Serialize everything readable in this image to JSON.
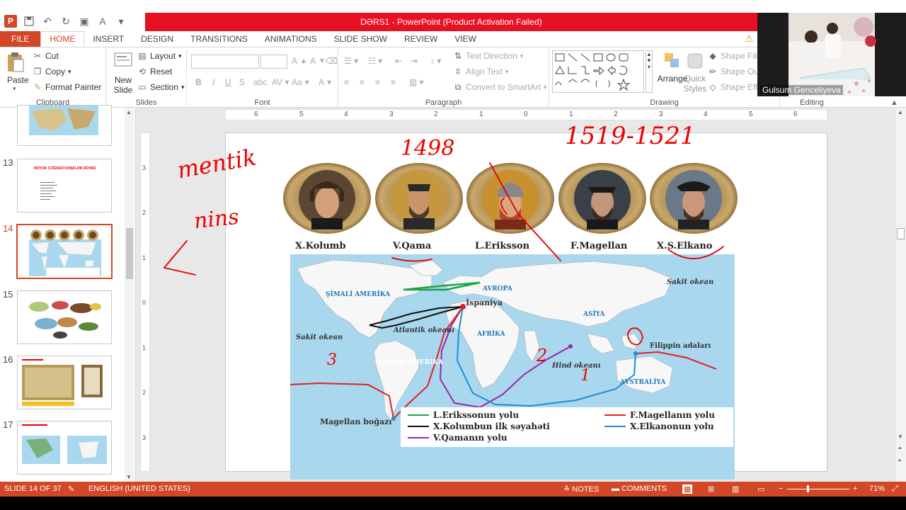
{
  "window": {
    "title": "DƏRS1 - PowerPoint (Product Activation Failed)",
    "app_icon_letter": "P"
  },
  "tabs": [
    "FILE",
    "HOME",
    "INSERT",
    "DESIGN",
    "TRANSITIONS",
    "ANIMATIONS",
    "SLIDE SHOW",
    "REVIEW",
    "VIEW"
  ],
  "active_tab": "HOME",
  "ribbon": {
    "clipboard": {
      "label": "Clipboard",
      "paste": "Paste",
      "cut": "Cut",
      "copy": "Copy",
      "format_painter": "Format Painter"
    },
    "slides": {
      "label": "Slides",
      "new_slide": "New Slide",
      "layout": "Layout",
      "reset": "Reset",
      "section": "Section"
    },
    "font": {
      "label": "Font",
      "bold": "B",
      "italic": "I",
      "underline": "U",
      "strike": "S",
      "aa": "Aa",
      "font_color": "A"
    },
    "paragraph": {
      "label": "Paragraph",
      "text_direction": "Text Direction",
      "align_text": "Align Text",
      "convert_smartart": "Convert to SmartArt"
    },
    "drawing": {
      "label": "Drawing",
      "arrange": "Arrange",
      "quick_styles": "Quick Styles",
      "shape_fill": "Shape Fill",
      "shape_outline": "Shape Outl",
      "shape_effects": "Shape Effe"
    },
    "editing": {
      "label": "Editing"
    }
  },
  "ruler": {
    "marks": [
      "6",
      "5",
      "4",
      "3",
      "2",
      "1",
      "0",
      "1",
      "2",
      "3",
      "4",
      "5",
      "6"
    ]
  },
  "vruler": {
    "marks": [
      "3",
      "2",
      "1",
      "0",
      "1",
      "2",
      "3"
    ]
  },
  "thumbnails": [
    {
      "num": "13",
      "title": "BÖYÜK COĞRAFİ KƏŞFLƏR DÖVRÜ"
    },
    {
      "num": "14",
      "selected": true
    },
    {
      "num": "15"
    },
    {
      "num": "16"
    },
    {
      "num": "17"
    }
  ],
  "slide": {
    "explorers": [
      "X.Kolumb",
      "V.Qama",
      "L.Eriksson",
      "F.Magellan",
      "X.S.Elkano"
    ],
    "map_labels": {
      "north_america": "ŞİMALİ AMERİKA",
      "europe": "AVROPA",
      "spain": "İspaniya",
      "asia": "ASİYA",
      "africa": "AFRİKA",
      "atlantic": "Atlantik okeanı",
      "pacific_left": "Sakit okean",
      "pacific_right": "Sakit okean",
      "south_america": "CƏNUBİ AMERİKA",
      "indian_ocean": "Hind okeanı",
      "australia": "AVSTRALİYA",
      "philippines": "Filippin adaları",
      "magellan_strait": "Magellan boğazı"
    },
    "legend": [
      {
        "label": "L.Erikssonun yolu",
        "color": "#1ea34a"
      },
      {
        "label": "X.Kolumbun ilk səyahəti",
        "color": "#111111"
      },
      {
        "label": "V.Qamanın yolu",
        "color": "#9b27a8"
      },
      {
        "label": "F.Magellanın yolu",
        "color": "#e02020"
      },
      {
        "label": "X.Elkanonun yolu",
        "color": "#1e8fd0"
      }
    ],
    "annotations": [
      "1498",
      "1519-1521",
      "mentik",
      "nins",
      "3",
      "2",
      "1"
    ]
  },
  "webcam": {
    "name": "Gulsum Genceliyeva"
  },
  "status": {
    "slide": "SLIDE 14 OF 37",
    "language": "ENGLISH (UNITED STATES)",
    "notes": "NOTES",
    "comments": "COMMENTS",
    "zoom": "71%"
  },
  "colors": {
    "accent": "#d24726",
    "title_bar": "#e81123",
    "ink": "#e00000"
  }
}
